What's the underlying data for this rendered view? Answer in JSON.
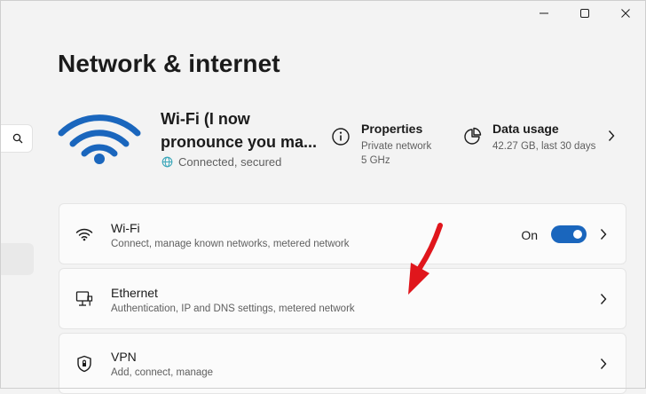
{
  "window": {
    "page_title": "Network & internet",
    "caption_icons": [
      "minimize-icon",
      "maximize-icon",
      "close-icon"
    ]
  },
  "nav": {
    "search_icon": "search-icon"
  },
  "hero": {
    "network_name": "Wi-Fi (I now pronounce you ma...",
    "status": "Connected, secured",
    "status_icon": "globe-icon",
    "properties": {
      "title": "Properties",
      "line1": "Private network",
      "line2": "5 GHz",
      "icon": "info-icon"
    },
    "data_usage": {
      "title": "Data usage",
      "line1": "42.27 GB, last 30 days",
      "icon": "pie-chart-icon"
    }
  },
  "items": [
    {
      "title": "Wi-Fi",
      "subtitle": "Connect, manage known networks, metered network",
      "icon": "wifi-icon",
      "toggle_label": "On",
      "toggle_on": true
    },
    {
      "title": "Ethernet",
      "subtitle": "Authentication, IP and DNS settings, metered network",
      "icon": "ethernet-icon"
    },
    {
      "title": "VPN",
      "subtitle": "Add, connect, manage",
      "icon": "shield-icon"
    }
  ],
  "colors": {
    "accent": "#1a66bd",
    "wifi_hero": "#1a66bd",
    "annotation": "#e0161c"
  }
}
